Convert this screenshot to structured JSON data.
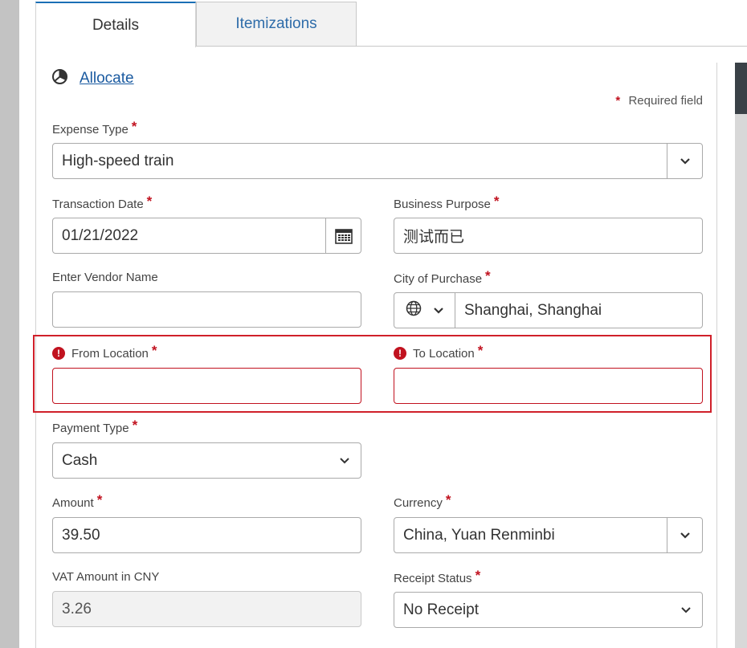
{
  "tabs": [
    {
      "label": "Details",
      "active": true
    },
    {
      "label": "Itemizations",
      "active": false
    }
  ],
  "allocate": {
    "label": "Allocate",
    "icon": "pie-chart-icon"
  },
  "required_note": {
    "star": "*",
    "text": "Required field"
  },
  "form": {
    "expense_type": {
      "label": "Expense Type",
      "required": "*",
      "value": "High-speed train"
    },
    "transaction_date": {
      "label": "Transaction Date",
      "required": "*",
      "value": "01/21/2022"
    },
    "business_purpose": {
      "label": "Business Purpose",
      "required": "*",
      "value": "测试而已"
    },
    "vendor_name": {
      "label": "Enter Vendor Name",
      "value": ""
    },
    "city_of_purchase": {
      "label": "City of Purchase",
      "required": "*",
      "value": "Shanghai, Shanghai"
    },
    "from_location": {
      "label": "From Location",
      "required": "*",
      "value": "",
      "error_icon": "!"
    },
    "to_location": {
      "label": "To Location",
      "required": "*",
      "value": "",
      "error_icon": "!"
    },
    "payment_type": {
      "label": "Payment Type",
      "required": "*",
      "value": "Cash"
    },
    "amount": {
      "label": "Amount",
      "required": "*",
      "value": "39.50"
    },
    "currency": {
      "label": "Currency",
      "required": "*",
      "value": "China, Yuan Renminbi"
    },
    "vat_amount": {
      "label": "VAT Amount in CNY",
      "value": "3.26"
    },
    "receipt_status": {
      "label": "Receipt Status",
      "required": "*",
      "value": "No Receipt"
    }
  },
  "colors": {
    "accent": "#1a6fb5",
    "link": "#1a5aa0",
    "error": "#c1121f"
  }
}
